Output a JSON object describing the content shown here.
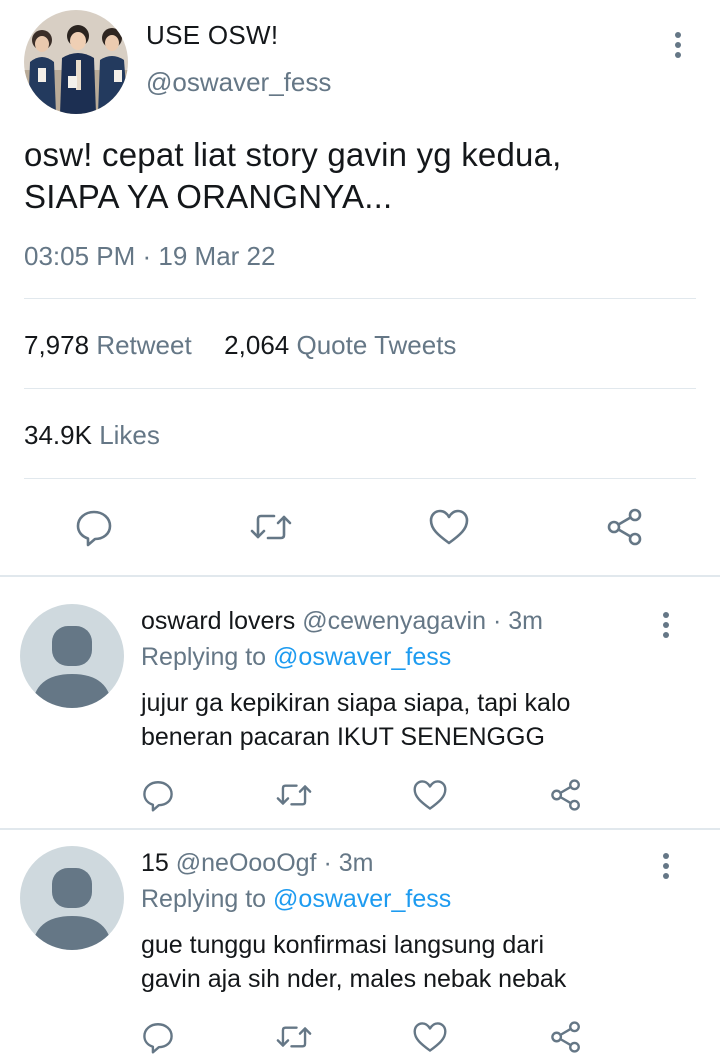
{
  "tweet": {
    "display_name": "USE OSW!",
    "handle": "@oswaver_fess",
    "text_line1": "osw! cepat liat story gavin yg kedua,",
    "text_line2": "SIAPA YA ORANGNYA...",
    "timestamp": "03:05 PM · 19 Mar 22",
    "retweets": "7,978",
    "retweets_label": "Retweet",
    "quotes": "2,064",
    "quotes_label": "Quote Tweets",
    "likes": "34.9K",
    "likes_label": "Likes",
    "avatar_icon": "group-photo-avatar"
  },
  "replies": [
    {
      "name": "osward lovers",
      "handle": "@cewenyagavin",
      "time": "· 3m",
      "replying_label": "Replying to",
      "replying_to": "@oswaver_fess",
      "text_line1": "jujur ga kepikiran siapa siapa, tapi kalo",
      "text_line2": "beneran pacaran IKUT SENENGGG"
    },
    {
      "name": "15",
      "handle": "@neOooOgf",
      "time": "· 3m",
      "replying_label": "Replying to",
      "replying_to": "@oswaver_fess",
      "text_line1": "gue tunggu konfirmasi langsung dari",
      "text_line2": "gavin aja sih nder, males nebak nebak"
    }
  ],
  "icons": {
    "reply": "reply-icon",
    "retweet": "retweet-icon",
    "like": "heart-icon",
    "share": "share-icon",
    "more": "more-vertical-icon",
    "default_avatar": "default-avatar-icon"
  },
  "colors": {
    "text": "#14171a",
    "muted": "#657786",
    "link": "#1d9bf0",
    "divider": "#e1e8ed",
    "avatar_bg": "#cfd9de",
    "avatar_fg": "#657786"
  }
}
